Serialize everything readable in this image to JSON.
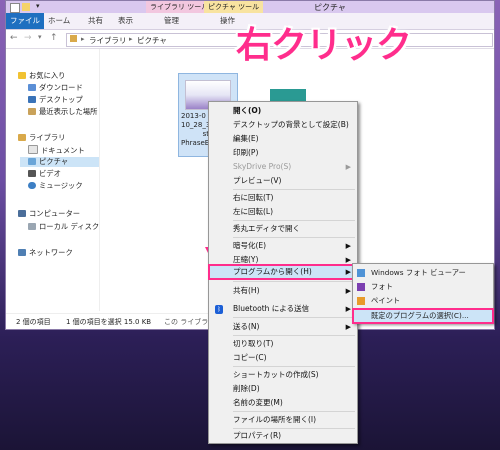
{
  "window": {
    "title": "ピクチャ",
    "quick_access": [
      "new-icon",
      "folder-icon"
    ],
    "context_tab_library": "ライブラリ ツール",
    "context_tab_picture": "ピクチャ ツール",
    "tabs": [
      "ファイル",
      "ホーム",
      "共有",
      "表示",
      "管理",
      "操作"
    ]
  },
  "address": {
    "path": [
      "ライブラリ",
      "ピクチャ"
    ]
  },
  "nav": {
    "favorites": "お気に入り",
    "fav_items": [
      "ダウンロード",
      "デスクトップ",
      "最近表示した場所"
    ],
    "libraries": "ライブラリ",
    "lib_items": [
      "ドキュメント",
      "ピクチャ",
      "ビデオ",
      "ミュージック"
    ],
    "computer": "コンピューター",
    "computer_items": [
      "ローカル ディスク (C:)"
    ],
    "network": "ネットワーク"
  },
  "content": {
    "file1_caption": [
      "2013-0",
      "10_28_3",
      "ste",
      "PhraseEx"
    ],
    "colors": {
      "thumb2": "#2a9a93",
      "selected": "#cfe3f7"
    }
  },
  "status": {
    "items": "2 個の項目",
    "selected": "1 個の項目を選択  15.0 KB",
    "library_note": "この ライブラリ に"
  },
  "callout": "右クリック",
  "context_menu": {
    "items": [
      {
        "label": "開く(O)",
        "bold": true
      },
      {
        "label": "デスクトップの背景として設定(B)"
      },
      {
        "label": "編集(E)"
      },
      {
        "label": "印刷(P)"
      },
      {
        "label": "SkyDrive Pro(S)",
        "disabled": true,
        "submenu": true
      },
      {
        "label": "プレビュー(V)"
      },
      {
        "label": "右に回転(T)"
      },
      {
        "label": "左に回転(L)"
      },
      {
        "label": "秀丸エディタで開く"
      },
      {
        "label": "暗号化(E)",
        "submenu": true
      },
      {
        "label": "圧縮(Y)",
        "submenu": true
      },
      {
        "label": "プログラムから開く(H)",
        "submenu": true,
        "highlighted": true
      },
      {
        "label": "共有(H)",
        "submenu": true
      },
      {
        "label": "Bluetooth による送信",
        "submenu": true
      },
      {
        "label": "送る(N)",
        "submenu": true
      },
      {
        "label": "切り取り(T)"
      },
      {
        "label": "コピー(C)"
      },
      {
        "label": "ショートカットの作成(S)"
      },
      {
        "label": "削除(D)"
      },
      {
        "label": "名前の変更(M)"
      },
      {
        "label": "ファイルの場所を開く(I)"
      },
      {
        "label": "プロパティ(R)"
      }
    ]
  },
  "submenu": {
    "items": [
      {
        "label": "Windows フォト ビューアー"
      },
      {
        "label": "フォト"
      },
      {
        "label": "ペイント"
      },
      {
        "label": "既定のプログラムの選択(C)...",
        "highlighted": true
      }
    ]
  },
  "colors": {
    "accent": "#ff2d8c",
    "file_tab": "#1e6fc0",
    "menu_highlight": "#cce4f7"
  }
}
